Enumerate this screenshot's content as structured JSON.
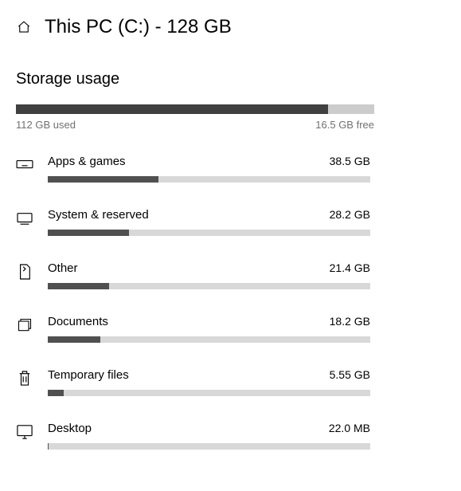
{
  "header": {
    "title": "This PC (C:) - 128 GB"
  },
  "section_title": "Storage usage",
  "overall": {
    "used_label": "112 GB used",
    "free_label": "16.5 GB free",
    "used_percent": 87.1
  },
  "categories": [
    {
      "icon": "apps",
      "name": "Apps & games",
      "size": "38.5 GB",
      "percent": 34.4
    },
    {
      "icon": "system",
      "name": "System & reserved",
      "size": "28.2 GB",
      "percent": 25.2
    },
    {
      "icon": "other",
      "name": "Other",
      "size": "21.4 GB",
      "percent": 19.1
    },
    {
      "icon": "documents",
      "name": "Documents",
      "size": "18.2 GB",
      "percent": 16.3
    },
    {
      "icon": "temp",
      "name": "Temporary files",
      "size": "5.55 GB",
      "percent": 4.96
    },
    {
      "icon": "desktop",
      "name": "Desktop",
      "size": "22.0 MB",
      "percent": 0.02
    }
  ]
}
